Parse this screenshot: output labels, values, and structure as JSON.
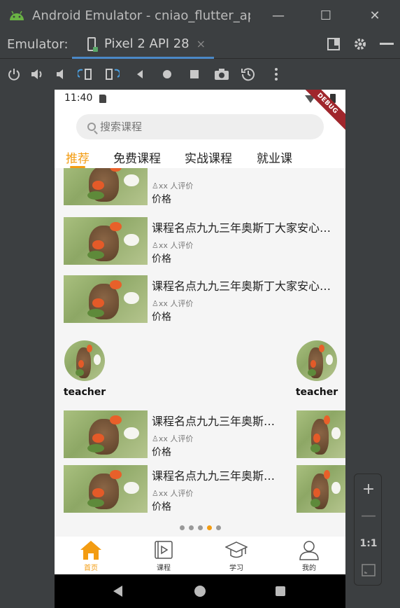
{
  "window": {
    "title": "Android Emulator - cniao_flutter_app",
    "minimize_glyph": "—",
    "maximize_glyph": "☐",
    "close_glyph": "✕"
  },
  "emulator_bar": {
    "label": "Emulator:",
    "tab_label": "Pixel 2 API 28",
    "tab_close": "×"
  },
  "phone": {
    "status_time": "11:40",
    "debug_banner": "DEBUG",
    "search_placeholder": "搜索课程",
    "tabs": [
      {
        "label": "推荐",
        "active": true
      },
      {
        "label": "免费课程",
        "active": false
      },
      {
        "label": "实战课程",
        "active": false
      },
      {
        "label": "就业课",
        "active": false
      }
    ],
    "courses": [
      {
        "title": "",
        "meta": "♙xx 人评价",
        "price": "价格"
      },
      {
        "title": "课程名点九九三年奥斯丁大家安心…",
        "meta": "♙xx 人评价",
        "price": "价格"
      },
      {
        "title": "课程名点九九三年奥斯丁大家安心…",
        "meta": "♙xx 人评价",
        "price": "价格"
      }
    ],
    "teachers": [
      {
        "name": "teacher"
      },
      {
        "name": "teacher"
      }
    ],
    "card_courses": [
      {
        "title": "课程名点九九三年奥斯…",
        "meta": "♙xx 人评价",
        "price": "价格"
      },
      {
        "title": "课程名点九九三年奥斯…",
        "meta": "♙xx 人评价",
        "price": "价格"
      }
    ],
    "carousel": {
      "pages": 5,
      "active_index": 3
    },
    "bottom_nav": [
      {
        "label": "首页",
        "icon": "home-icon",
        "active": true
      },
      {
        "label": "课程",
        "icon": "play-book-icon",
        "active": false
      },
      {
        "label": "学习",
        "icon": "graduation-cap-icon",
        "active": false
      },
      {
        "label": "我的",
        "icon": "person-icon",
        "active": false
      }
    ]
  },
  "zoom_panel": {
    "zoom_in": "+",
    "zoom_out": "—",
    "actual_size": "1:1"
  },
  "colors": {
    "accent": "#f39c12",
    "ide_background": "#3c3f41",
    "tab_underline": "#4a88c7",
    "debug_banner": "#a0262c"
  }
}
